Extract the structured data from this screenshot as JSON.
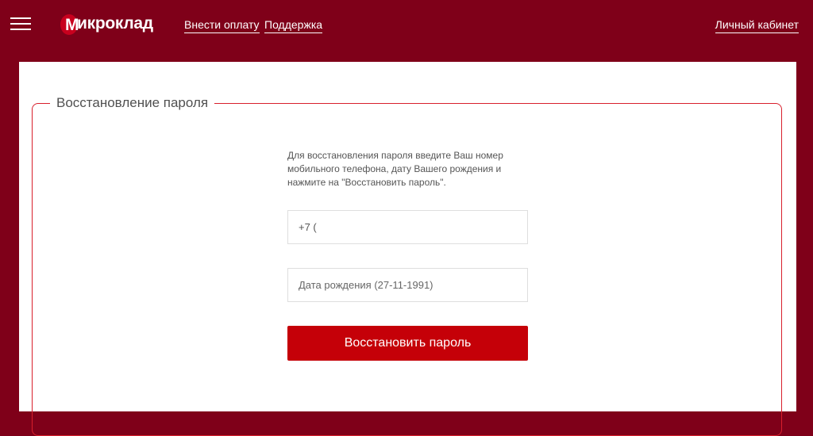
{
  "header": {
    "menu_icon": "hamburger-menu-icon",
    "logo_mark_letter": "М",
    "logo_text": "икроклад",
    "nav": {
      "pay": "Внести оплату",
      "support": "Поддержка",
      "cabinet": "Личный кабинет"
    }
  },
  "form": {
    "legend": "Восстановление пароля",
    "instructions": "Для восстановления пароля введите Ваш номер мобильного телефона, дату Вашего рождения и нажмите на \"Восстановить пароль\".",
    "phone_value": "+7 (",
    "dob_placeholder": "Дата рождения (27-11-1991)",
    "submit_label": "Восстановить пароль"
  },
  "colors": {
    "brand_dark": "#7f0019",
    "accent_red": "#c50008",
    "border_red": "#d81f2c"
  }
}
